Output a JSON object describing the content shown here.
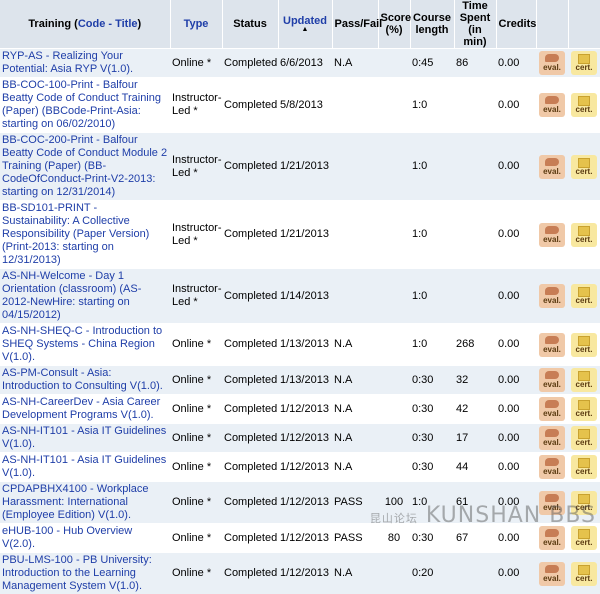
{
  "headers": {
    "training": "Training (",
    "code": "Code",
    "sep": " - ",
    "title": "Title",
    "close": ")",
    "type": "Type",
    "status": "Status",
    "updated": "Updated",
    "sort_arrow": "▲",
    "passfail": "Pass/Fail",
    "score": "Score (%)",
    "course_length": "Course length",
    "time_spent": "Time Spent (in min)",
    "credits": "Credits"
  },
  "buttons": {
    "eval": "eval.",
    "cert": "cert."
  },
  "rows": [
    {
      "training": "RYP-AS - Realizing Your Potential: Asia RYP V(1.0).",
      "type": "Online *",
      "status": "Completed",
      "updated": "6/6/2013",
      "passfail": "N.A",
      "score": "",
      "length": "0:45",
      "spent": "86",
      "credits": "0.00"
    },
    {
      "training": "BB-COC-100-Print - Balfour Beatty Code of Conduct Training (Paper) (BBCode-Print-Asia: starting on 06/02/2010)",
      "type": "Instructor-Led *",
      "status": "Completed",
      "updated": "5/8/2013",
      "passfail": "",
      "score": "",
      "length": "1:0",
      "spent": "",
      "credits": "0.00"
    },
    {
      "training": "BB-COC-200-Print - Balfour Beatty Code of Conduct Module 2 Training (Paper) (BB-CodeOfConduct-Print-V2-2013: starting on 12/31/2014)",
      "type": "Instructor-Led *",
      "status": "Completed",
      "updated": "1/21/2013",
      "passfail": "",
      "score": "",
      "length": "1:0",
      "spent": "",
      "credits": "0.00"
    },
    {
      "training": "BB-SD101-PRINT - Sustainability: A Collective Responsibility (Paper Version) (Print-2013: starting on 12/31/2013)",
      "type": "Instructor-Led *",
      "status": "Completed",
      "updated": "1/21/2013",
      "passfail": "",
      "score": "",
      "length": "1:0",
      "spent": "",
      "credits": "0.00"
    },
    {
      "training": "AS-NH-Welcome - Day 1 Orientation (classroom) (AS-2012-NewHire: starting on 04/15/2012)",
      "type": "Instructor-Led *",
      "status": "Completed",
      "updated": "1/14/2013",
      "passfail": "",
      "score": "",
      "length": "1:0",
      "spent": "",
      "credits": "0.00"
    },
    {
      "training": "AS-NH-SHEQ-C - Introduction to SHEQ Systems - China Region V(1.0).",
      "type": "Online *",
      "status": "Completed",
      "updated": "1/13/2013",
      "passfail": "N.A",
      "score": "",
      "length": "1:0",
      "spent": "268",
      "credits": "0.00"
    },
    {
      "training": "AS-PM-Consult - Asia: Introduction to Consulting V(1.0).",
      "type": "Online *",
      "status": "Completed",
      "updated": "1/13/2013",
      "passfail": "N.A",
      "score": "",
      "length": "0:30",
      "spent": "32",
      "credits": "0.00"
    },
    {
      "training": "AS-NH-CareerDev - Asia Career Development Programs V(1.0).",
      "type": "Online *",
      "status": "Completed",
      "updated": "1/12/2013",
      "passfail": "N.A",
      "score": "",
      "length": "0:30",
      "spent": "42",
      "credits": "0.00"
    },
    {
      "training": "AS-NH-IT101 - Asia IT Guidelines V(1.0).",
      "type": "Online *",
      "status": "Completed",
      "updated": "1/12/2013",
      "passfail": "N.A",
      "score": "",
      "length": "0:30",
      "spent": "17",
      "credits": "0.00"
    },
    {
      "training": "AS-NH-IT101 - Asia IT Guidelines V(1.0).",
      "type": "Online *",
      "status": "Completed",
      "updated": "1/12/2013",
      "passfail": "N.A",
      "score": "",
      "length": "0:30",
      "spent": "44",
      "credits": "0.00"
    },
    {
      "training": "CPDAPBHX4100 - Workplace Harassment: International (Employee Edition) V(1.0).",
      "type": "Online *",
      "status": "Completed",
      "updated": "1/12/2013",
      "passfail": "PASS",
      "score": "100",
      "length": "1:0",
      "spent": "61",
      "credits": "0.00"
    },
    {
      "training": "eHUB-100 - Hub Overview V(2.0).",
      "type": "Online *",
      "status": "Completed",
      "updated": "1/12/2013",
      "passfail": "PASS",
      "score": "80",
      "length": "0:30",
      "spent": "67",
      "credits": "0.00"
    },
    {
      "training": "PBU-LMS-100 - PB University: Introduction to the Learning Management System V(1.0).",
      "type": "Online *",
      "status": "Completed",
      "updated": "1/12/2013",
      "passfail": "N.A",
      "score": "",
      "length": "0:20",
      "spent": "",
      "credits": "0.00"
    }
  ],
  "watermark": {
    "main": "KUNSHAN BBS",
    "cn": "昆山论坛"
  }
}
